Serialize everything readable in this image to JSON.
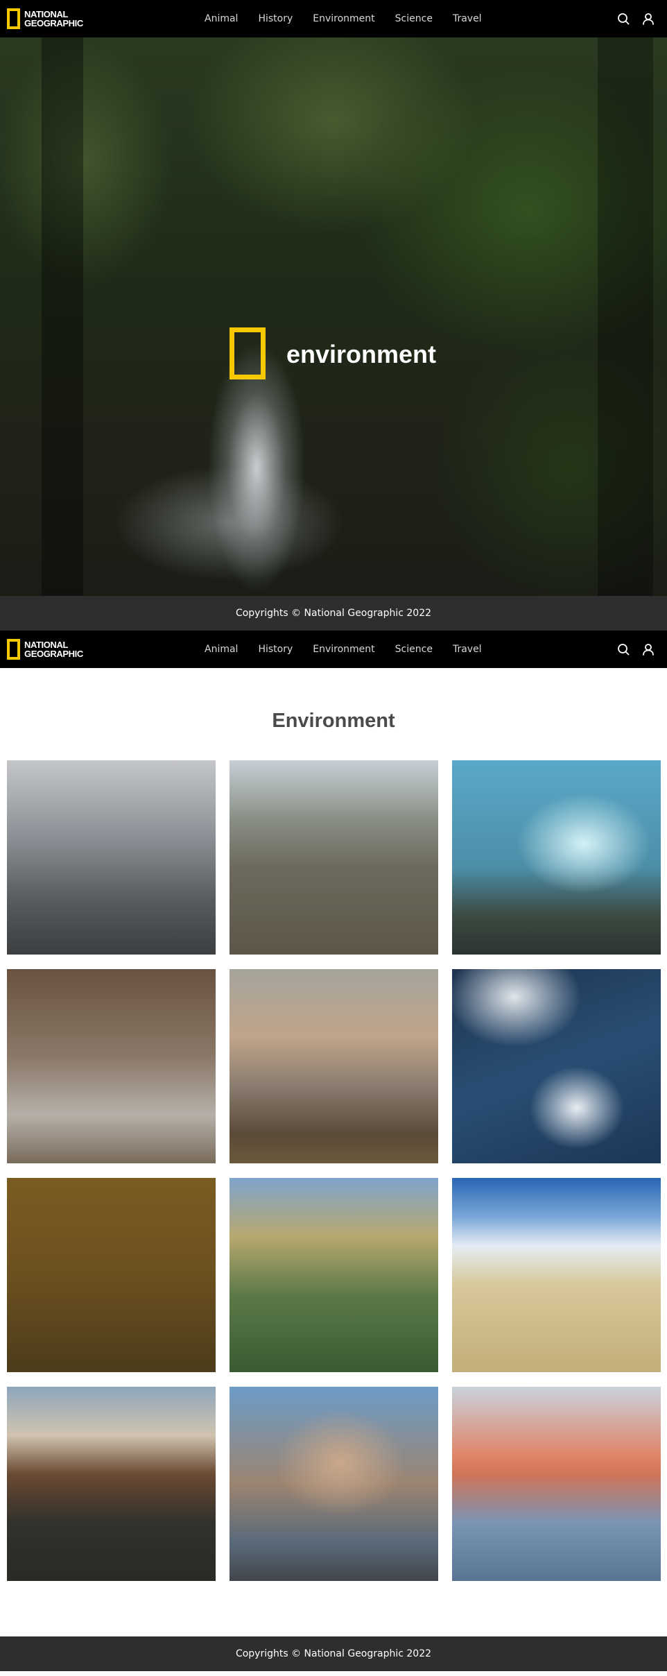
{
  "nav": {
    "logo_line1": "NATIONAL",
    "logo_line2": "GEOGRAPHIC",
    "links": [
      "Animal",
      "History",
      "Environment",
      "Science",
      "Travel"
    ],
    "icons": [
      "search-icon",
      "user-icon"
    ]
  },
  "hero": {
    "title": "environment"
  },
  "footer": {
    "copyright": "Copyrights © National Geographic 2022"
  },
  "section": {
    "title": "Environment"
  },
  "colors": {
    "nav_bg": "#000000",
    "logo_yellow": "#f5c800",
    "footer_bg": "#2e2e2e",
    "section_title": "#4a4a4a"
  }
}
